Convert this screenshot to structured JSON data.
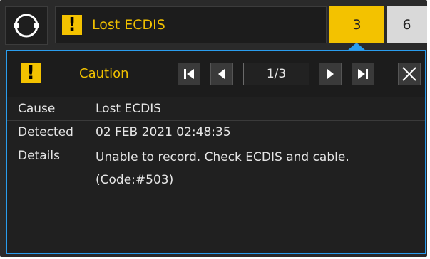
{
  "alert": {
    "title": "Lost ECDIS",
    "count_caution": "3",
    "count_other": "6"
  },
  "panel": {
    "severity_label": "Caution",
    "page_indicator": "1/3",
    "rows": [
      {
        "key": "Cause",
        "value": "Lost ECDIS"
      },
      {
        "key": "Detected",
        "value": "02 FEB 2021 02:48:35"
      },
      {
        "key": "Details",
        "value": "Unable to record. Check ECDIS and cable. (Code:#503)"
      }
    ]
  },
  "colors": {
    "accent": "#2a9dee",
    "caution": "#f3c200",
    "background": "#2a2a2a"
  },
  "icons": [
    "status-ring-icon",
    "warning-icon",
    "first-page-icon",
    "prev-page-icon",
    "next-page-icon",
    "last-page-icon",
    "close-icon"
  ]
}
